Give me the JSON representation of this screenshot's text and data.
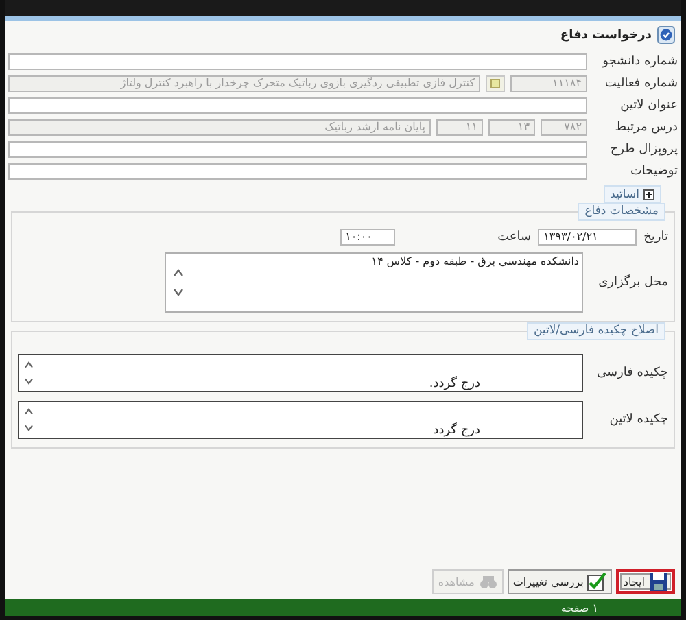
{
  "window": {
    "title": "درخواست دفاع"
  },
  "rows": [
    {
      "label": "شماره دانشجو",
      "kind": "plain",
      "disabled": false
    },
    {
      "label": "شماره فعالیت",
      "kind": "lookup",
      "code": "۱۱۱۸۴",
      "value": "کنترل فازی تطبیقی ردگیری بازوی رباتیک متحرک چرخدار با راهبرد کنترل ولتاژ",
      "disabled": true
    },
    {
      "label": "عنوان لاتین",
      "kind": "plain",
      "disabled": false
    },
    {
      "label": "درس مرتبط",
      "kind": "course",
      "parts": [
        "۷۸۲",
        "۱۳",
        "۱۱"
      ],
      "value": "پایان نامه ارشد رباتیک",
      "disabled": true
    },
    {
      "label": "پروپزال طرح",
      "kind": "plain",
      "disabled": false
    },
    {
      "label": "توضیحات",
      "kind": "plain",
      "disabled": false
    }
  ],
  "professors": {
    "title": "اساتید",
    "expanded": false
  },
  "defense": {
    "title": "مشخصات دفاع",
    "date_label": "تاریخ",
    "date": "۱۳۹۳/۰۲/۲۱",
    "time_label": "ساعت",
    "time": "۱۰:۰۰",
    "place_label": "محل برگزاری",
    "place": "دانشکده مهندسی برق - طبقه دوم - کلاس ۱۴"
  },
  "abstracts": {
    "title": "اصلاح چکیده فارسی/لاتین",
    "items": [
      {
        "label": "چکیده فارسی",
        "value": "درج گردد."
      },
      {
        "label": "چکیده لاتین",
        "value": "درج گردد"
      }
    ]
  },
  "buttons": [
    {
      "label": "ایجاد",
      "kind": "save",
      "disabled": false,
      "highlighted": true
    },
    {
      "label": "بررسی تغییرات",
      "kind": "check",
      "disabled": false,
      "highlighted": false
    },
    {
      "label": "مشاهده",
      "kind": "view",
      "disabled": true,
      "highlighted": false
    }
  ],
  "status_bar": {
    "page": "۱ صفحه"
  }
}
